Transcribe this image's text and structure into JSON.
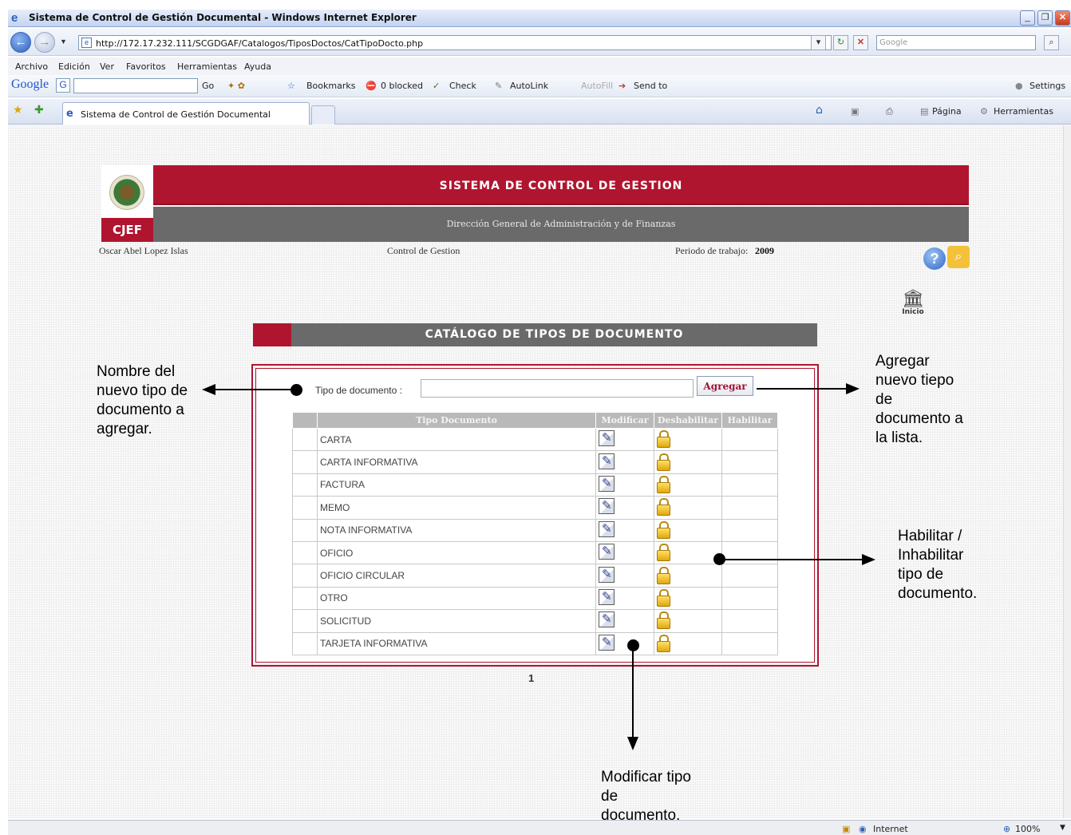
{
  "window": {
    "title": "Sistema de Control de Gestión Documental - Windows Internet Explorer",
    "url": "http://172.17.232.111/SCGDGAF/Catalogos/TiposDoctos/CatTipoDocto.php",
    "search_placeholder": "Google"
  },
  "menu": [
    "Archivo",
    "Edición",
    "Ver",
    "Favoritos",
    "Herramientas",
    "Ayuda"
  ],
  "google_toolbar": {
    "logo": "Google",
    "go": "Go",
    "bookmarks": "Bookmarks",
    "blocked": "0 blocked",
    "check": "Check",
    "autolink": "AutoLink",
    "autofill": "AutoFill",
    "send_to": "Send to",
    "settings": "Settings"
  },
  "tab": {
    "label": "Sistema de Control de Gestión Documental"
  },
  "commands": {
    "pagina": "Página",
    "herramientas": "Herramientas"
  },
  "status": {
    "zone": "Internet",
    "zoom": "100%"
  },
  "header": {
    "title": "SISTEMA DE CONTROL DE GESTION",
    "subtitle": "Dirección General de Administración y de Finanzas",
    "logo_text": "CJEF",
    "user": "Oscar Abel Lopez Islas",
    "section": "Control de Gestion",
    "period_label": "Periodo de trabajo:",
    "period_value": "2009",
    "home_label": "Inicio"
  },
  "catalog": {
    "title": "CATÁLOGO DE TIPOS DE DOCUMENTO",
    "field_label": "Tipo de documento :",
    "field_value": "",
    "add_button": "Agregar",
    "columns": [
      "",
      "Tipo Documento",
      "Modificar",
      "Deshabilitar",
      "Habilitar"
    ],
    "rows": [
      "CARTA",
      "CARTA INFORMATIVA",
      "FACTURA",
      "MEMO",
      "NOTA INFORMATIVA",
      "OFICIO",
      "OFICIO CIRCULAR",
      "OTRO",
      "SOLICITUD",
      "TARJETA INFORMATIVA"
    ],
    "page": "1"
  },
  "annotations": {
    "name": [
      "Nombre del",
      "nuevo tipo de",
      "documento a",
      "agregar."
    ],
    "add": [
      "Agregar",
      "nuevo tiepo",
      "de",
      "documento a",
      "la lista."
    ],
    "enable": [
      "Habilitar /",
      "Inhabilitar",
      "tipo de",
      "documento."
    ],
    "modify": [
      "Modificar tipo",
      "de",
      "documento."
    ]
  }
}
